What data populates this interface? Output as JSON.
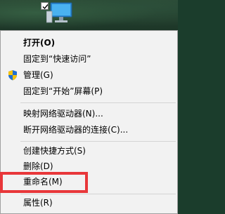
{
  "desktop": {
    "icon_name": "this-pc-icon",
    "checkbox_state": "checked"
  },
  "context_menu": {
    "items": [
      {
        "label": "打开(O)",
        "bold": true
      },
      {
        "label": "固定到“快速访问”"
      },
      {
        "label": "管理(G)",
        "icon": "shield-icon"
      },
      {
        "label": "固定到“开始”屏幕(P)"
      },
      {
        "label": "映射网络驱动器(N)..."
      },
      {
        "label": "断开网络驱动器的连接(C)..."
      },
      {
        "label": "创建快捷方式(S)"
      },
      {
        "label": "删除(D)"
      },
      {
        "label": "重命名(M)"
      },
      {
        "label": "属性(R)"
      }
    ]
  },
  "colors": {
    "menu_bg": "#f2f2f2",
    "separator": "#d4d4d4",
    "highlight": "#e8373a",
    "shield_blue": "#1f6fd1",
    "shield_yellow": "#f4c20d"
  }
}
